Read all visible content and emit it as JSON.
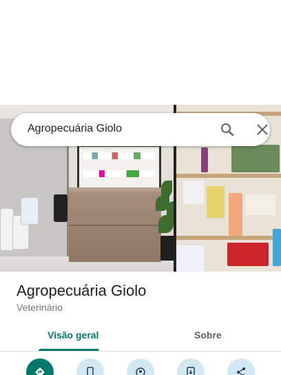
{
  "search": {
    "query": "Agropecuária Giolo"
  },
  "place": {
    "name": "Agropecuária Giolo",
    "category": "Veterinário"
  },
  "tabs": [
    {
      "label": "Visão geral",
      "selected": true
    },
    {
      "label": "Sobre",
      "selected": false
    }
  ],
  "actions": [
    {
      "icon": "directions-icon"
    },
    {
      "icon": "phone-icon"
    },
    {
      "icon": "save-icon"
    },
    {
      "icon": "send-to-phone-icon"
    },
    {
      "icon": "share-icon"
    }
  ],
  "colors": {
    "accent": "#01796f",
    "action_background": "#d2e8f5"
  }
}
